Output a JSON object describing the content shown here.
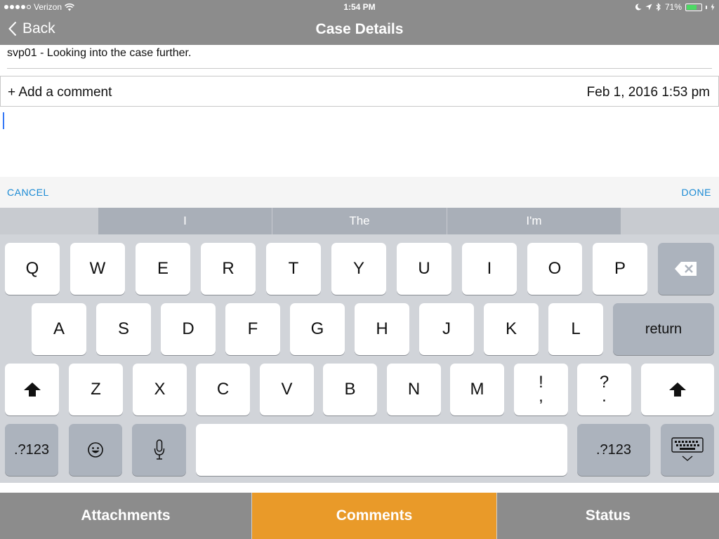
{
  "status_bar": {
    "carrier": "Verizon",
    "time": "1:54 PM",
    "battery": "71%",
    "battery_level": 0.71,
    "icons": [
      "wifi-icon",
      "moon-icon",
      "location-icon",
      "bluetooth-icon",
      "battery-icon",
      "charging-icon"
    ]
  },
  "nav": {
    "back_label": "Back",
    "title": "Case Details"
  },
  "content": {
    "previous_comment": "svp01 - Looking into the case further.",
    "add_comment_label": "+ Add a comment",
    "comment_date": "Feb 1, 2016 1:53 pm",
    "comment_text": ""
  },
  "actions": {
    "cancel": "CANCEL",
    "done": "DONE"
  },
  "keyboard": {
    "predictions": [
      "I",
      "The",
      "I'm"
    ],
    "row1": [
      "Q",
      "W",
      "E",
      "R",
      "T",
      "Y",
      "U",
      "I",
      "O",
      "P"
    ],
    "row2": [
      "A",
      "S",
      "D",
      "F",
      "G",
      "H",
      "J",
      "K",
      "L"
    ],
    "return_label": "return",
    "row3": [
      "Z",
      "X",
      "C",
      "V",
      "B",
      "N",
      "M"
    ],
    "punct1_top": "!",
    "punct1_bottom": ",",
    "punct2_top": "?",
    "punct2_bottom": ".",
    "numbers_label": ".?123"
  },
  "tabs": [
    {
      "label": "Attachments",
      "active": false
    },
    {
      "label": "Comments",
      "active": true
    },
    {
      "label": "Status",
      "active": false
    }
  ],
  "colors": {
    "bar_gray": "#8c8c8c",
    "active_tab": "#e99a29",
    "link_blue": "#1a8ad4",
    "caret_blue": "#3478f6"
  }
}
